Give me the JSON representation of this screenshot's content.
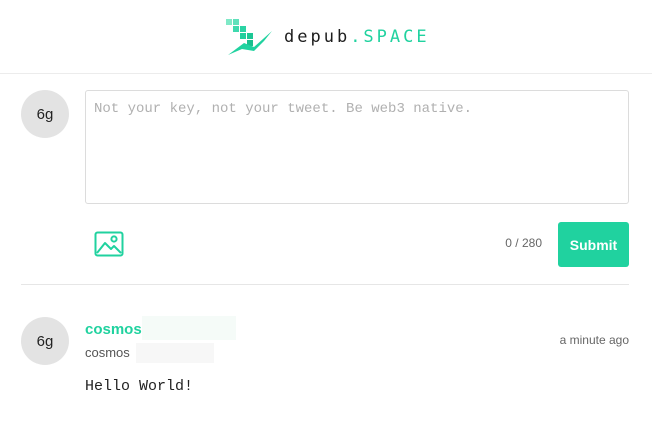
{
  "header": {
    "brand_main": "depub",
    "brand_suffix": ".SPACE",
    "logo_icon": "bird-logo-icon",
    "accent_color": "#20d29f"
  },
  "compose": {
    "avatar_text": "6g",
    "placeholder": "Not your key, not your tweet. Be web3 native.",
    "value": "",
    "image_icon": "image-icon",
    "counter": "0 / 280",
    "submit_label": "Submit"
  },
  "post": {
    "avatar_text": "6g",
    "display_name": "cosmos",
    "handle": "cosmos",
    "time": "a minute ago",
    "body": "Hello World!"
  }
}
